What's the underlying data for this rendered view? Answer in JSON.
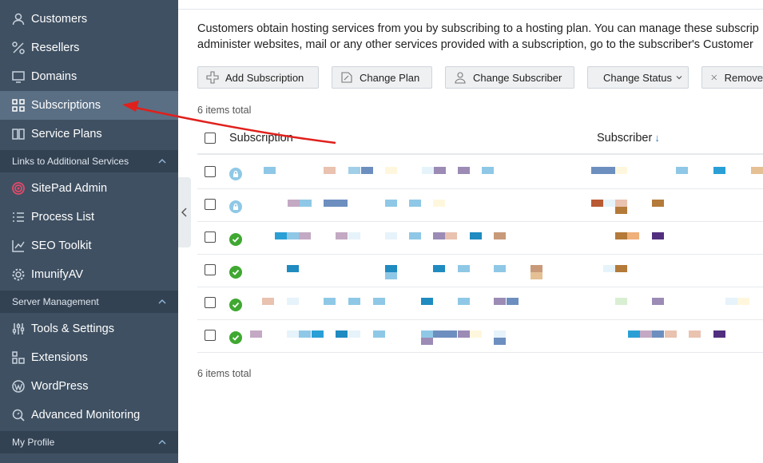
{
  "sidebar": {
    "items": [
      {
        "label": "Customers",
        "icon": "user-icon"
      },
      {
        "label": "Resellers",
        "icon": "percent-icon"
      },
      {
        "label": "Domains",
        "icon": "monitor-icon"
      },
      {
        "label": "Subscriptions",
        "icon": "grid-icon",
        "active": true
      },
      {
        "label": "Service Plans",
        "icon": "book-icon"
      }
    ],
    "section_links": "Links to Additional Services",
    "links": [
      {
        "label": "SitePad Admin",
        "icon": "sitepad-icon"
      },
      {
        "label": "Process List",
        "icon": "list-icon"
      },
      {
        "label": "SEO Toolkit",
        "icon": "chart-icon"
      },
      {
        "label": "ImunifyAV",
        "icon": "gear-icon"
      }
    ],
    "section_server": "Server Management",
    "server": [
      {
        "label": "Tools & Settings",
        "icon": "sliders-icon"
      },
      {
        "label": "Extensions",
        "icon": "blocks-icon"
      },
      {
        "label": "WordPress",
        "icon": "wordpress-icon"
      },
      {
        "label": "Advanced Monitoring",
        "icon": "search-gauge-icon"
      }
    ],
    "section_profile": "My Profile"
  },
  "main": {
    "description_line1": "Customers obtain hosting services from you by subscribing to a hosting plan. You can manage these subscrip",
    "description_line2": "administer websites, mail or any other services provided with a subscription, go to the subscriber's Customer",
    "toolbar": {
      "add": "Add Subscription",
      "change_plan": "Change Plan",
      "change_subscriber": "Change Subscriber",
      "change_status": "Change Status",
      "remove": "Remove"
    },
    "items_total_top": "6 items total",
    "items_total_bottom": "6 items total",
    "columns": {
      "subscription": "Subscription",
      "subscriber": "Subscriber",
      "sort_arrow": "↓"
    },
    "rows": [
      {
        "status": "locked"
      },
      {
        "status": "locked"
      },
      {
        "status": "active"
      },
      {
        "status": "active"
      },
      {
        "status": "active"
      },
      {
        "status": "active"
      }
    ]
  },
  "colors": {
    "sidebar_bg": "#3f5062",
    "sidebar_active": "#5a6f84",
    "section_bg": "#334252",
    "annotation_arrow": "#e0201c",
    "status_ok": "#3fa831"
  }
}
